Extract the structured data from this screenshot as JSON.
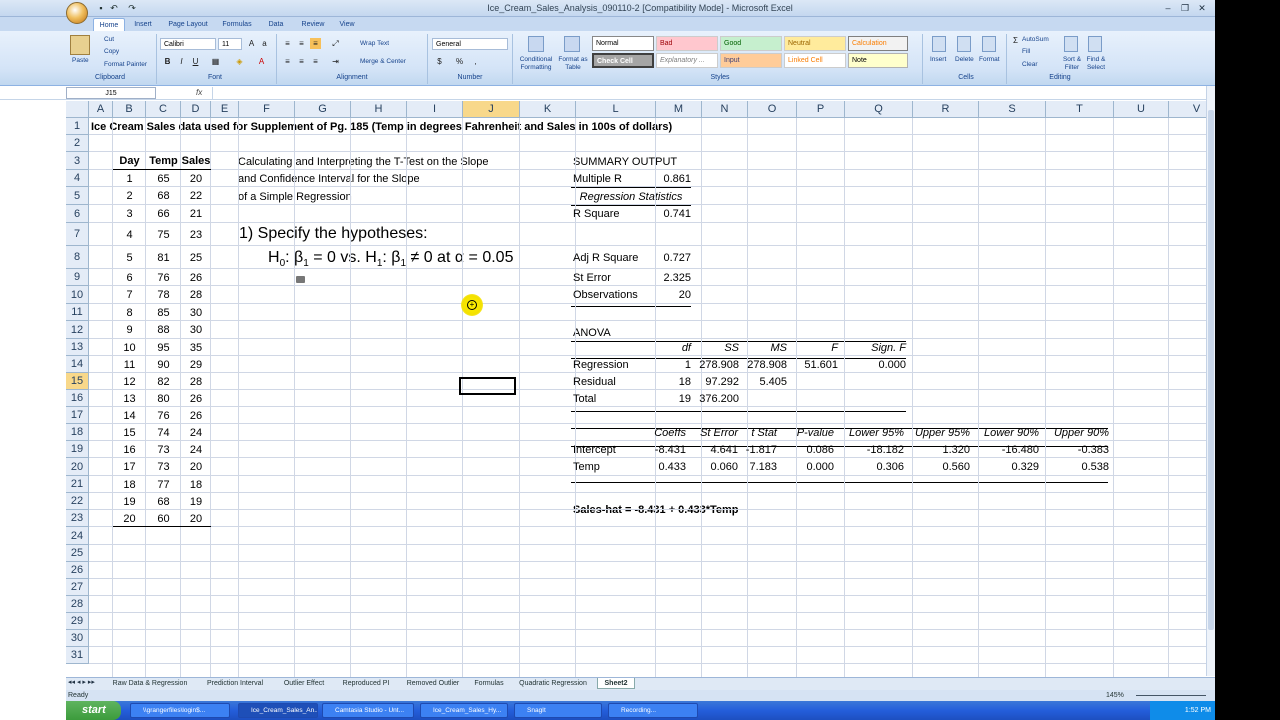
{
  "window": {
    "title": "Ice_Cream_Sales_Analysis_090110-2  [Compatibility Mode] - Microsoft Excel"
  },
  "ribbon": {
    "tabs": [
      "Home",
      "Insert",
      "Page Layout",
      "Formulas",
      "Data",
      "Review",
      "View"
    ],
    "clipboard": {
      "paste": "Paste",
      "cut": "Cut",
      "copy": "Copy",
      "format_painter": "Format Painter",
      "label": "Clipboard"
    },
    "font": {
      "name": "Calibri",
      "size": "11",
      "label": "Font"
    },
    "alignment": {
      "wrap": "Wrap Text",
      "merge": "Merge & Center",
      "label": "Alignment"
    },
    "number": {
      "format": "General",
      "label": "Number"
    },
    "styles": {
      "cond": "Conditional Formatting",
      "table": "Format as Table",
      "normal": "Normal",
      "bad": "Bad",
      "good": "Good",
      "neutral": "Neutral",
      "calculation": "Calculation",
      "check": "Check Cell",
      "explanatory": "Explanatory ...",
      "input": "Input",
      "linked": "Linked Cell",
      "note": "Note",
      "label": "Styles"
    },
    "cells": {
      "insert": "Insert",
      "delete": "Delete",
      "format": "Format",
      "label": "Cells"
    },
    "editing": {
      "autosum": "AutoSum",
      "fill": "Fill",
      "clear": "Clear",
      "sort": "Sort & Filter",
      "find": "Find & Select",
      "label": "Editing"
    }
  },
  "formula_bar": {
    "name_box": "J15",
    "fx": "fx",
    "content": ""
  },
  "columns": [
    "A",
    "B",
    "C",
    "D",
    "E",
    "F",
    "G",
    "H",
    "I",
    "J",
    "K",
    "L",
    "M",
    "N",
    "O",
    "P",
    "Q",
    "R",
    "S",
    "T",
    "U",
    "V"
  ],
  "rows": [
    "1",
    "2",
    "3",
    "4",
    "5",
    "6",
    "7",
    "8",
    "9",
    "10",
    "11",
    "12",
    "13",
    "14",
    "15",
    "16",
    "17",
    "18",
    "19",
    "20",
    "21",
    "22",
    "23",
    "24",
    "25",
    "26",
    "27",
    "28",
    "29",
    "30",
    "31"
  ],
  "sheet": {
    "title": "Ice Cream Sales data used for Supplement of Pg. 185 (Temp in degrees Fahrenheit and Sales in 100s of dollars)",
    "table_headers": [
      "Day",
      "Temp",
      "Sales"
    ],
    "table": [
      [
        "1",
        "65",
        "20"
      ],
      [
        "2",
        "68",
        "22"
      ],
      [
        "3",
        "66",
        "21"
      ],
      [
        "4",
        "75",
        "23"
      ],
      [
        "5",
        "81",
        "25"
      ],
      [
        "6",
        "76",
        "26"
      ],
      [
        "7",
        "78",
        "28"
      ],
      [
        "8",
        "85",
        "30"
      ],
      [
        "9",
        "88",
        "30"
      ],
      [
        "10",
        "95",
        "35"
      ],
      [
        "11",
        "90",
        "29"
      ],
      [
        "12",
        "82",
        "28"
      ],
      [
        "13",
        "80",
        "26"
      ],
      [
        "14",
        "76",
        "26"
      ],
      [
        "15",
        "74",
        "24"
      ],
      [
        "16",
        "73",
        "24"
      ],
      [
        "17",
        "73",
        "20"
      ],
      [
        "18",
        "77",
        "18"
      ],
      [
        "19",
        "68",
        "19"
      ],
      [
        "20",
        "60",
        "20"
      ]
    ],
    "desc1": "Calculating and Interpreting the T-Test on the Slope",
    "desc2": "and Confidence Interval for the Slope",
    "desc3": "of a Simple Regression",
    "step1": "1)  Specify the hypotheses:",
    "hypothesis": {
      "h0": "H",
      "h0_sub": "0",
      "h0_rest": ": β",
      "b1_sub": "1",
      "eq": " = 0  vs.  H",
      "h1_sub": "1",
      "h1_rest": ": β",
      "b1b_sub": "1",
      "neq": " ≠ 0  at α = 0.05"
    },
    "summary": {
      "title": "SUMMARY OUTPUT",
      "reg_stats_title": "Regression Statistics",
      "reg_stats": [
        [
          "Multiple R",
          "0.861"
        ],
        [
          "R Square",
          "0.741"
        ],
        [
          "Adj R Square",
          "0.727"
        ],
        [
          "St Error",
          "2.325"
        ],
        [
          "Observations",
          "20"
        ]
      ],
      "anova_title": "ANOVA",
      "anova_headers": [
        "df",
        "SS",
        "MS",
        "F",
        "Sign. F"
      ],
      "anova_rows": [
        [
          "Regression",
          "1",
          "278.908",
          "278.908",
          "51.601",
          "0.000"
        ],
        [
          "Residual",
          "18",
          "97.292",
          "5.405",
          "",
          ""
        ],
        [
          "Total",
          "19",
          "376.200",
          "",
          "",
          ""
        ]
      ],
      "coef_headers": [
        "Coeffs",
        "St Error",
        "t Stat",
        "P-value",
        "Lower 95%",
        "Upper 95%",
        "Lower 90%",
        "Upper 90%"
      ],
      "coef_rows": [
        [
          "Intercept",
          "-8.431",
          "4.641",
          "-1.817",
          "0.086",
          "-18.182",
          "1.320",
          "-16.480",
          "-0.383"
        ],
        [
          "Temp",
          "0.433",
          "0.060",
          "7.183",
          "0.000",
          "0.306",
          "0.560",
          "0.329",
          "0.538"
        ]
      ],
      "equation": "Sales-hat = -8.431 + 0.433*Temp"
    }
  },
  "sheet_tabs": [
    "Raw Data & Regression",
    "Prediction Interval",
    "Outlier Effect",
    "Reproduced PI",
    "Removed Outlier",
    "Formulas",
    "Quadratic Regression",
    "Sheet2"
  ],
  "status": {
    "ready": "Ready",
    "zoom": "145%"
  },
  "taskbar": {
    "start": "start",
    "items": [
      "\\\\grangerfiles\\login$...",
      "Ice_Cream_Sales_An...",
      "Camtasia Studio - Unt...",
      "Ice_Cream_Sales_Hy...",
      "SnagIt",
      "Recording..."
    ],
    "clock": "1:52 PM"
  }
}
